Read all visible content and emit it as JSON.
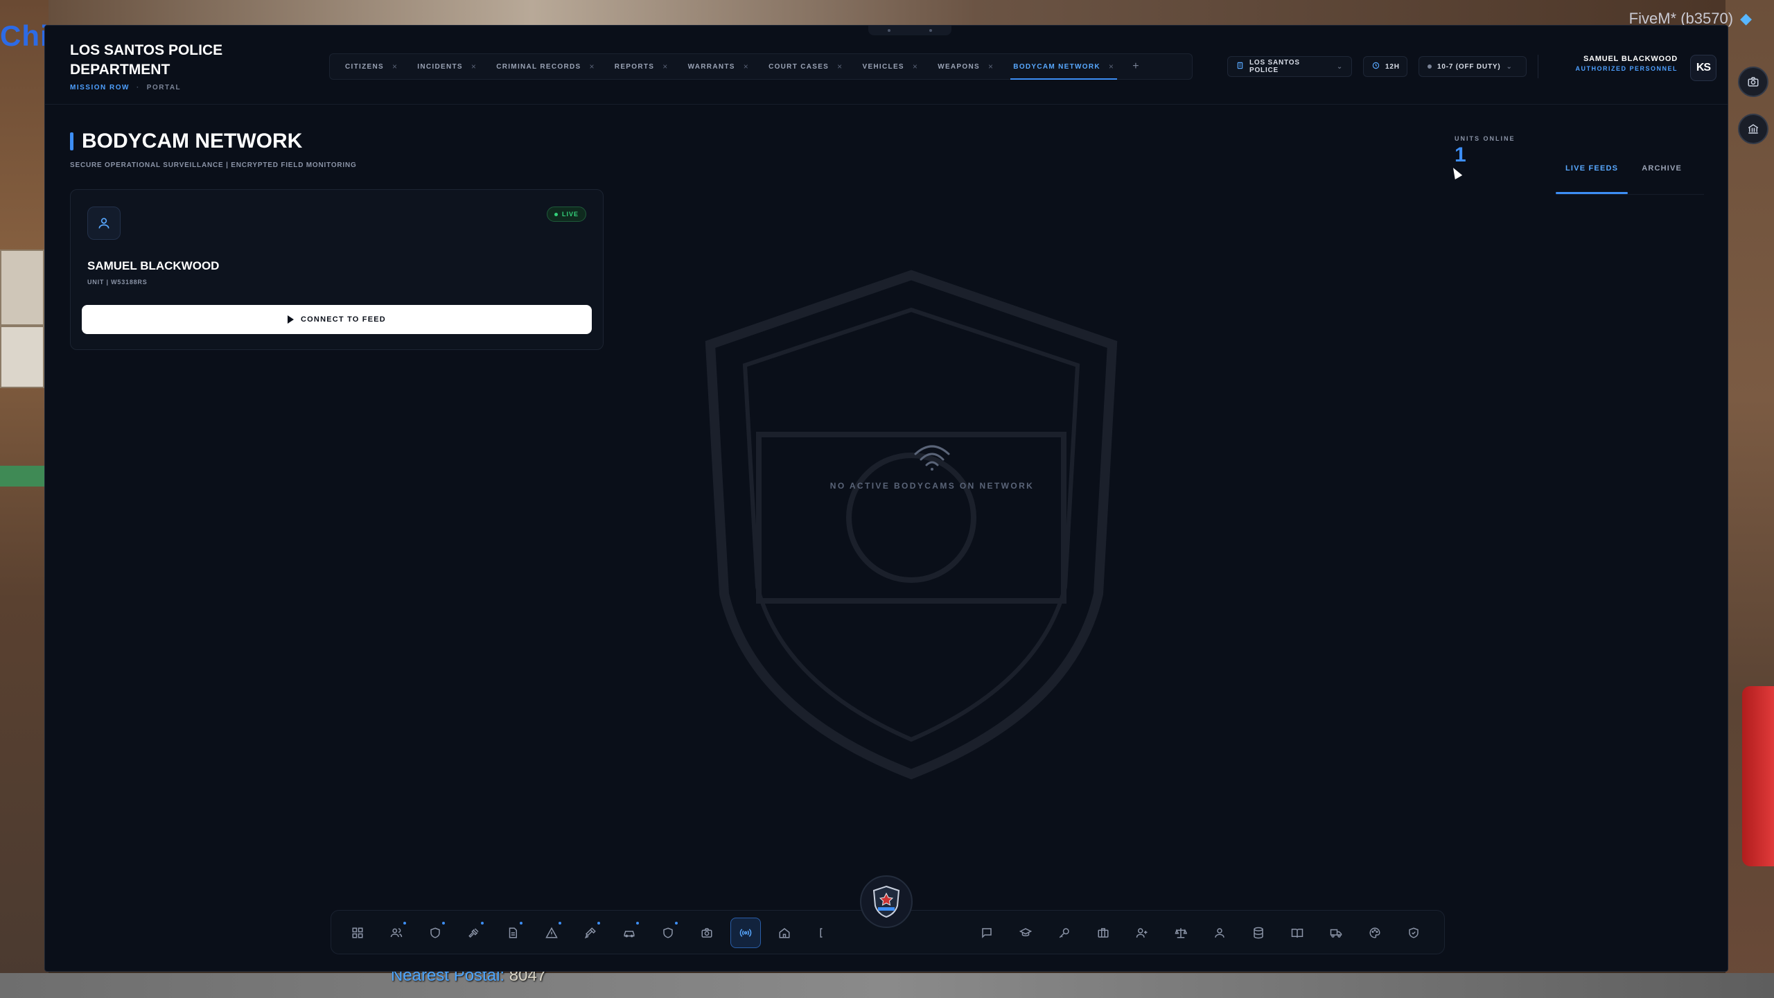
{
  "game": {
    "sign_text": "Chi",
    "overlay": "_FiveM* (b3570)",
    "postal_label": "Nearest Postal:",
    "postal_value": "8047",
    "side_buttons": [
      "camera-icon",
      "bank-icon"
    ]
  },
  "brand": {
    "title": "LOS SANTOS POLICE DEPARTMENT",
    "location": "MISSION ROW",
    "separator": "·",
    "portal": "PORTAL"
  },
  "tabs": [
    {
      "label": "CITIZENS"
    },
    {
      "label": "INCIDENTS"
    },
    {
      "label": "CRIMINAL RECORDS"
    },
    {
      "label": "REPORTS"
    },
    {
      "label": "WARRANTS"
    },
    {
      "label": "COURT CASES"
    },
    {
      "label": "VEHICLES"
    },
    {
      "label": "WEAPONS"
    },
    {
      "label": "BODYCAM NETWORK",
      "active": true
    }
  ],
  "tab_add": "+",
  "tab_close": "×",
  "header": {
    "department": "LOS SANTOS POLICE",
    "clock": "12H",
    "status": "10-7 (OFF DUTY)",
    "user_name": "SAMUEL BLACKWOOD",
    "user_role": "AUTHORIZED PERSONNEL",
    "user_initials": "KS"
  },
  "page": {
    "title": "BODYCAM NETWORK",
    "subtitle": "SECURE OPERATIONAL SURVEILLANCE | ENCRYPTED FIELD MONITORING",
    "units_label": "UNITS ONLINE",
    "units_value": "1",
    "feed_tabs": [
      "LIVE FEEDS",
      "ARCHIVE"
    ]
  },
  "card": {
    "status": "LIVE",
    "name": "SAMUEL BLACKWOOD",
    "unit": "UNIT | W53188RS",
    "button": "CONNECT TO FEED"
  },
  "empty_state": {
    "text": "NO ACTIVE BODYCAMS ON NETWORK",
    "icon": "wifi-icon"
  },
  "dock": {
    "left_icons": [
      "dashboard-icon",
      "citizens-icon",
      "shield-icon",
      "gavel-icon",
      "report-icon",
      "warning-icon",
      "hammer-icon",
      "car-icon",
      "badge-icon",
      "camera-icon",
      "broadcast-icon",
      "home-icon",
      "bracket-icon"
    ],
    "right_icons": [
      "chat-icon",
      "graduation-icon",
      "key-icon",
      "briefcase-icon",
      "user-add-icon",
      "scales-icon",
      "users-icon",
      "database-icon",
      "book-icon",
      "truck-icon",
      "palette-icon",
      "shield-check-icon"
    ],
    "active_icon": "broadcast-icon"
  },
  "colors": {
    "accent": "#3d8ef5",
    "live": "#34d27a",
    "background": "#0a0f19"
  }
}
